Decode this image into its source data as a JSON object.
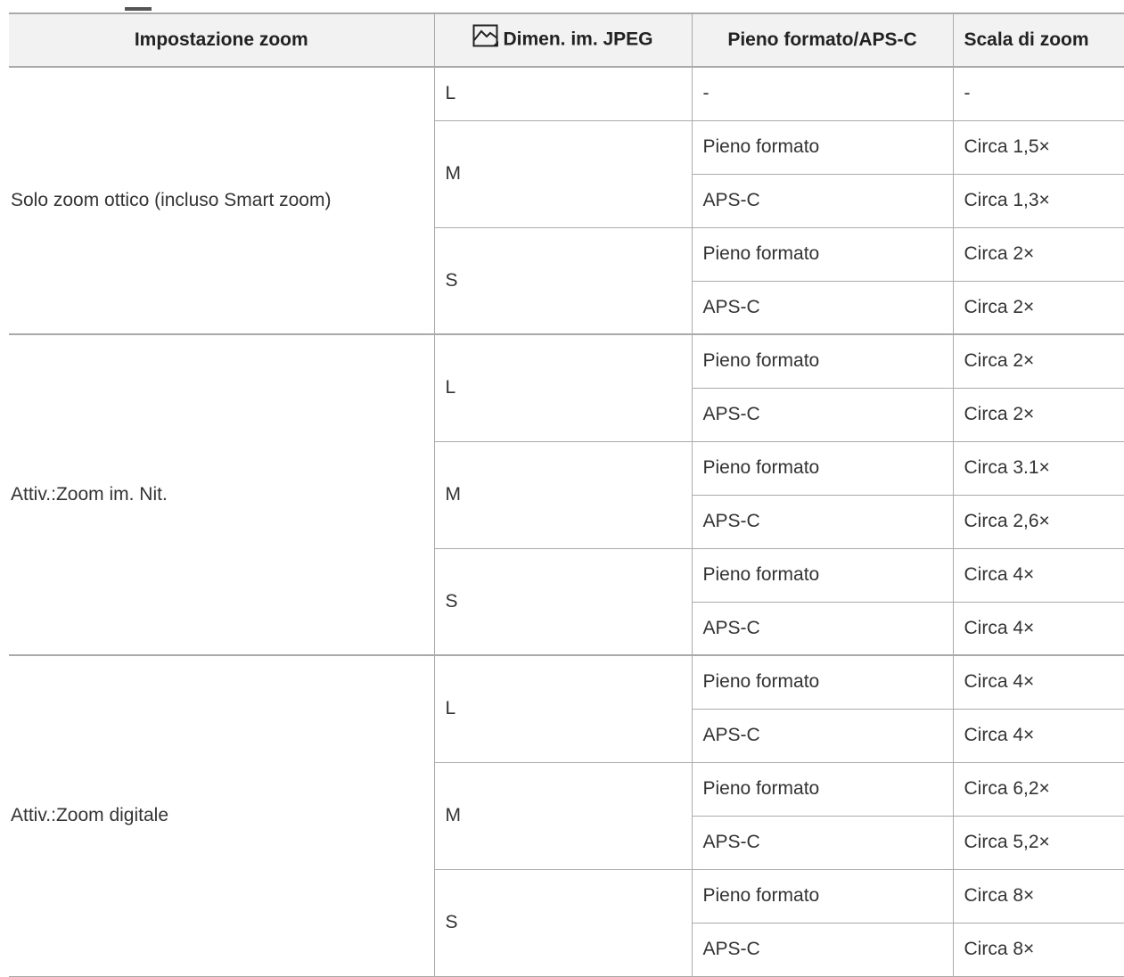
{
  "table": {
    "headers": [
      "Impostazione zoom",
      "Dimen. im. JPEG",
      "Pieno formato/APS-C",
      "Scala di zoom"
    ],
    "header_icon": "image-size-icon",
    "groups": [
      {
        "setting": "Solo zoom ottico (incluso Smart zoom)",
        "sizes": [
          {
            "size": "L",
            "rows": [
              {
                "format": "-",
                "scale": "-"
              }
            ]
          },
          {
            "size": "M",
            "rows": [
              {
                "format": "Pieno formato",
                "scale": "Circa 1,5×"
              },
              {
                "format": "APS-C",
                "scale": "Circa 1,3×"
              }
            ]
          },
          {
            "size": "S",
            "rows": [
              {
                "format": "Pieno formato",
                "scale": "Circa 2×"
              },
              {
                "format": "APS-C",
                "scale": "Circa 2×"
              }
            ]
          }
        ]
      },
      {
        "setting": "Attiv.:Zoom im. Nit.",
        "sizes": [
          {
            "size": "L",
            "rows": [
              {
                "format": "Pieno formato",
                "scale": "Circa 2×"
              },
              {
                "format": "APS-C",
                "scale": "Circa 2×"
              }
            ]
          },
          {
            "size": "M",
            "rows": [
              {
                "format": "Pieno formato",
                "scale": "Circa 3.1×"
              },
              {
                "format": "APS-C",
                "scale": "Circa 2,6×"
              }
            ]
          },
          {
            "size": "S",
            "rows": [
              {
                "format": "Pieno formato",
                "scale": "Circa 4×"
              },
              {
                "format": "APS-C",
                "scale": "Circa 4×"
              }
            ]
          }
        ]
      },
      {
        "setting": "Attiv.:Zoom digitale",
        "sizes": [
          {
            "size": "L",
            "rows": [
              {
                "format": "Pieno formato",
                "scale": "Circa 4×"
              },
              {
                "format": "APS-C",
                "scale": "Circa 4×"
              }
            ]
          },
          {
            "size": "M",
            "rows": [
              {
                "format": "Pieno formato",
                "scale": "Circa 6,2×"
              },
              {
                "format": "APS-C",
                "scale": "Circa 5,2×"
              }
            ]
          },
          {
            "size": "S",
            "rows": [
              {
                "format": "Pieno formato",
                "scale": "Circa 8×"
              },
              {
                "format": "APS-C",
                "scale": "Circa 8×"
              }
            ]
          }
        ]
      }
    ]
  }
}
